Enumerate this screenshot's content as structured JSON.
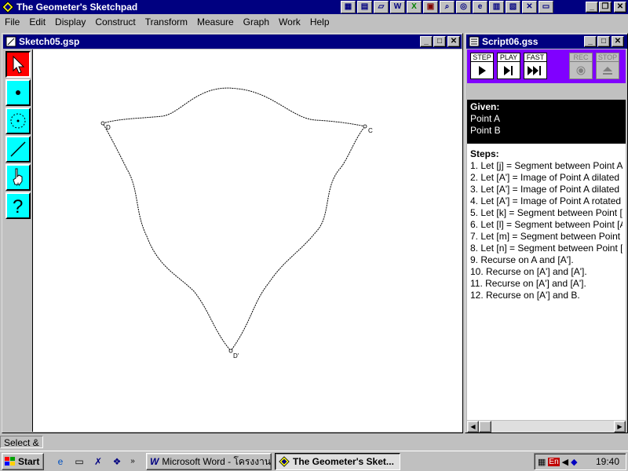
{
  "app": {
    "title": "The Geometer's Sketchpad"
  },
  "menu": [
    "File",
    "Edit",
    "Display",
    "Construct",
    "Transform",
    "Measure",
    "Graph",
    "Work",
    "Help"
  ],
  "sketch": {
    "title": "Sketch05.gsp",
    "points": {
      "d": "D",
      "c": "C",
      "d_prime": "D'"
    }
  },
  "script": {
    "title": "Script06.gss",
    "controls": {
      "step": "STEP",
      "play": "PLAY",
      "fast": "FAST",
      "rec": "REC",
      "stop": "STOP"
    },
    "given_header": "Given:",
    "given": [
      "Point A",
      "Point B"
    ],
    "steps_header": "Steps:",
    "steps": [
      "1. Let [j] = Segment between Point A",
      "2. Let [A'] = Image of Point A dilated I",
      "3. Let [A'] = Image of Point A dilated I",
      "4. Let [A'] = Image of Point A rotated",
      "5. Let [k] = Segment between Point [",
      "6. Let [l] = Segment between Point [A",
      "7. Let [m] = Segment between Point",
      "8. Let [n] = Segment between Point [",
      "9. Recurse on A and [A'].",
      "10. Recurse on [A'] and [A'].",
      "11. Recurse on [A'] and [A'].",
      "12. Recurse on [A'] and B."
    ]
  },
  "status": {
    "text": "Select &"
  },
  "taskbar": {
    "start": "Start",
    "tasks": [
      "Microsoft Word - โครงงาน",
      "The Geometer's Sket..."
    ],
    "lang": "En",
    "clock": "19:40"
  },
  "colors": {
    "title_active": "#000080",
    "tool_bg": "#00ffff",
    "tool_selected": "#ff0000",
    "script_controls": "#8000ff"
  }
}
